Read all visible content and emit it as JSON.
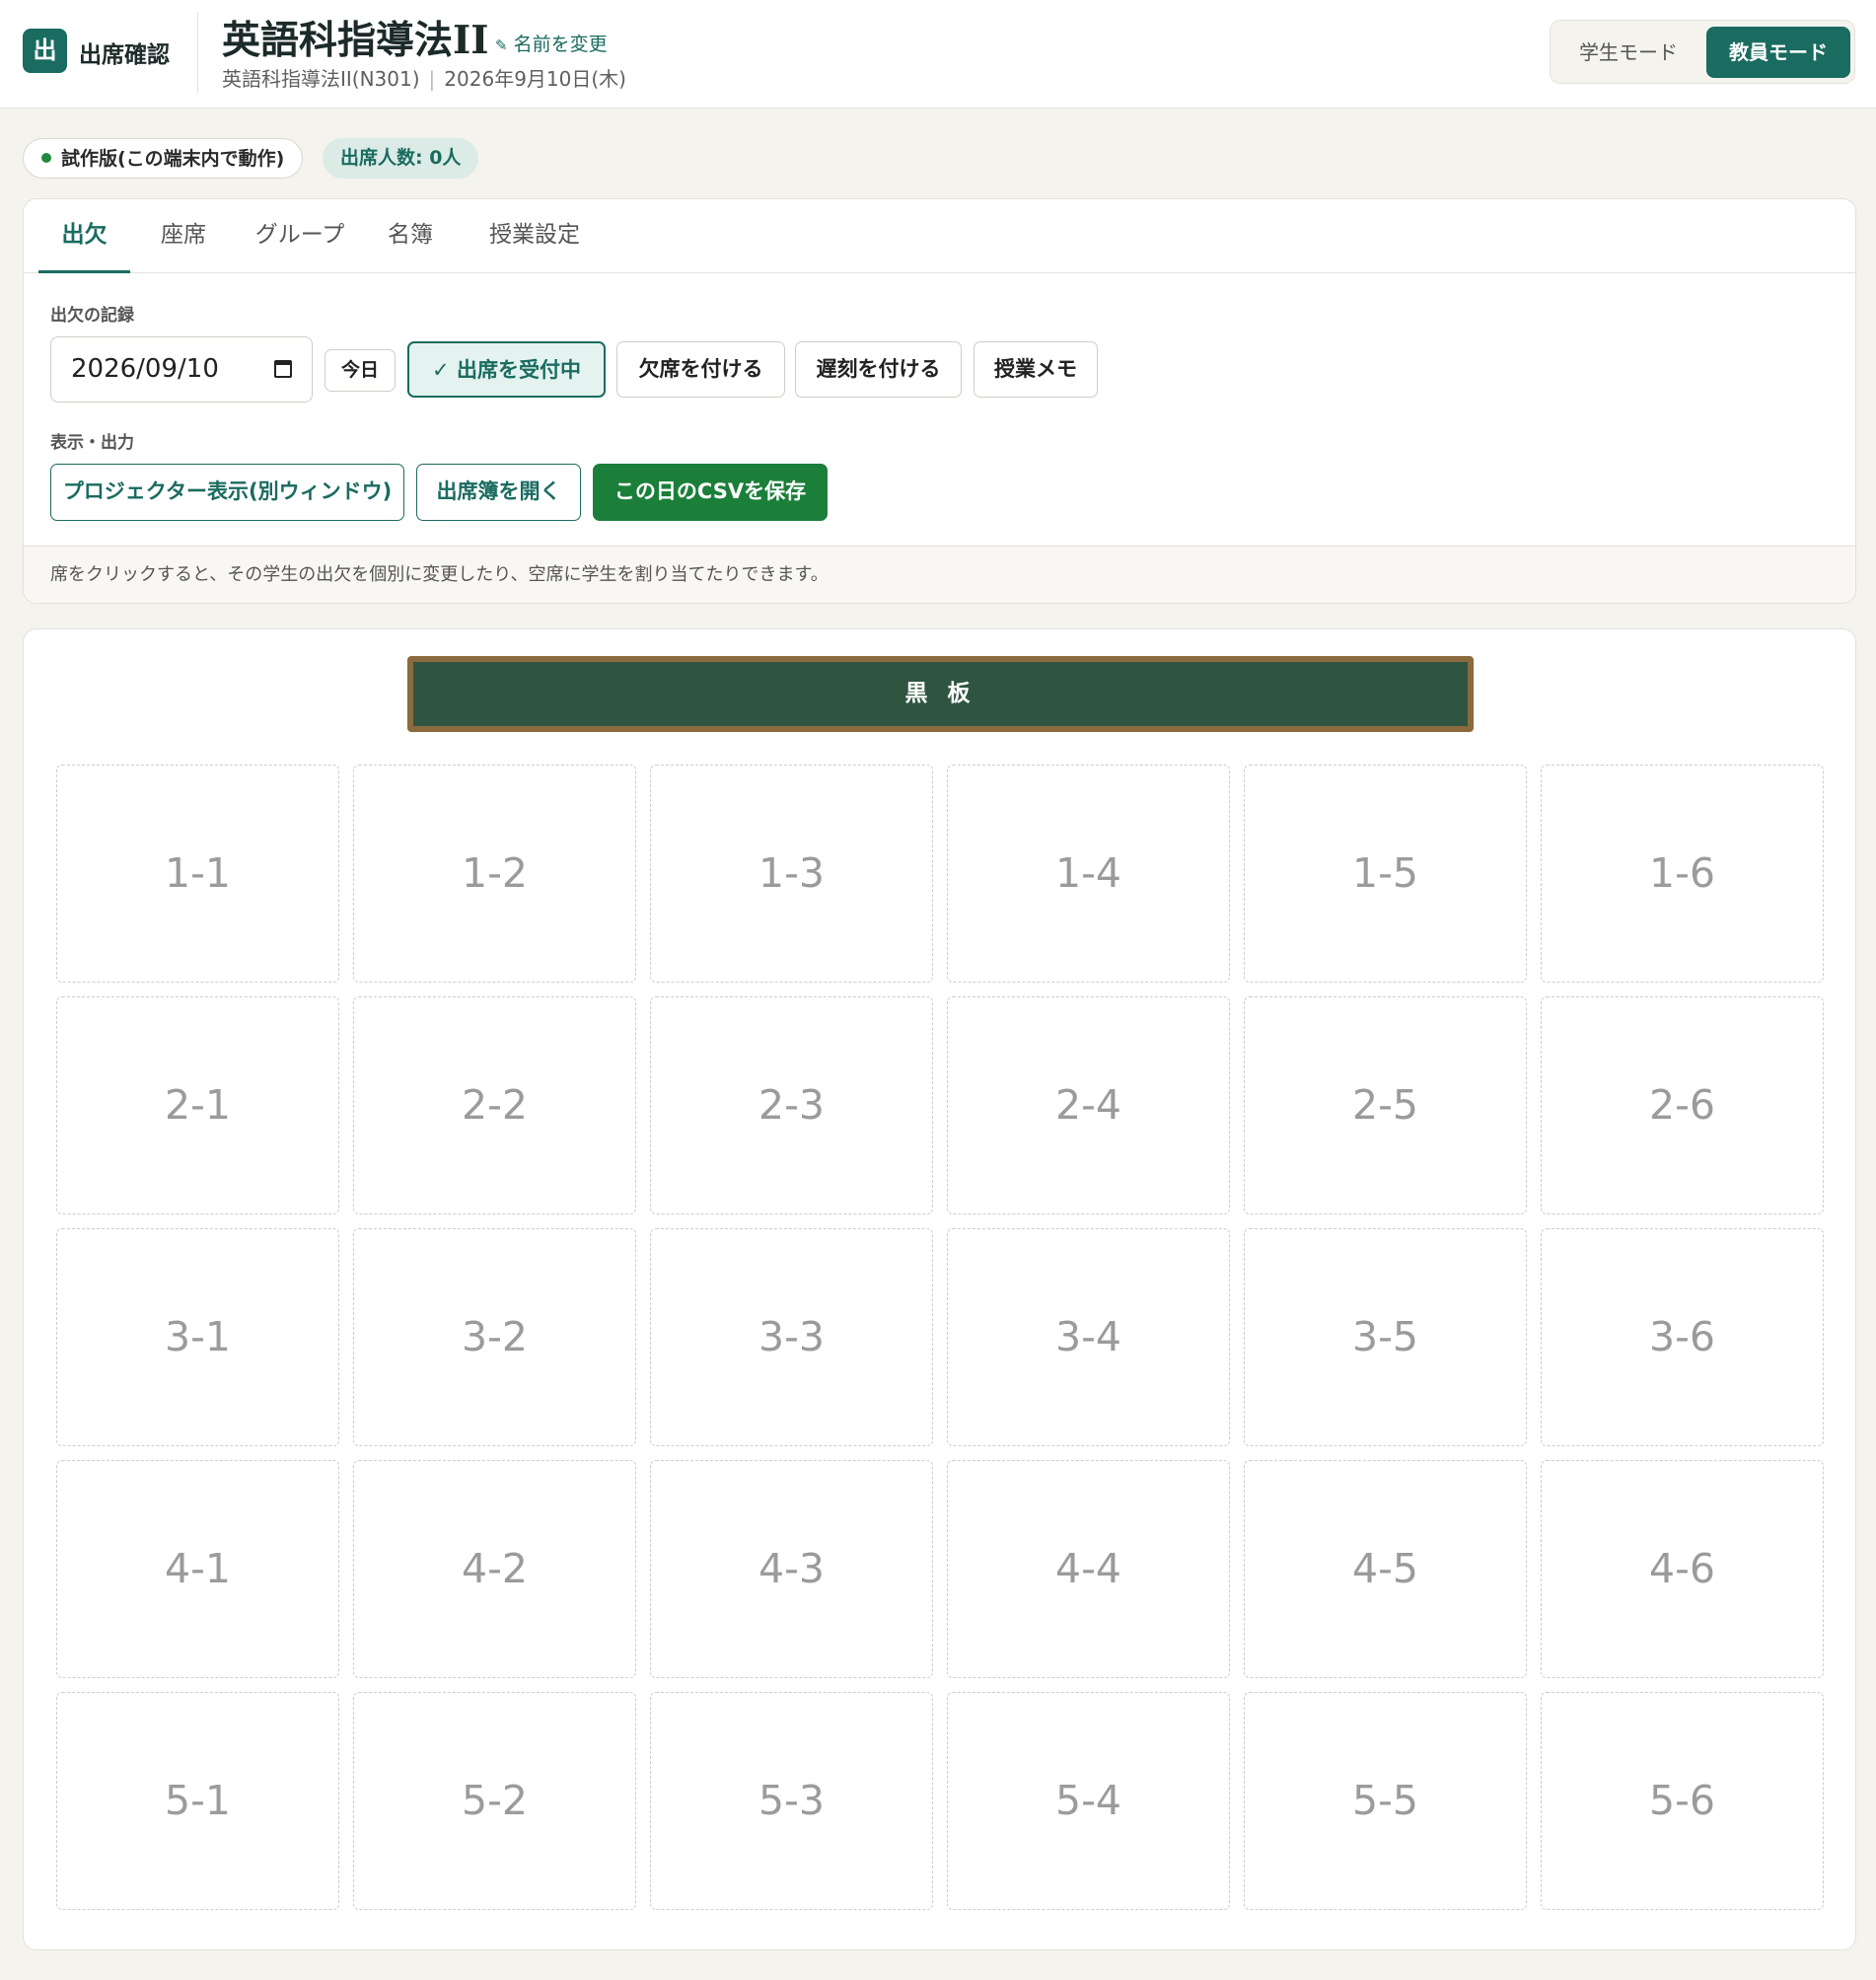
{
  "app": {
    "logo_char": "出",
    "name": "出席確認"
  },
  "course": {
    "title": "英語科指導法II",
    "rename_label": "名前を変更",
    "code": "英語科指導法II(N301)",
    "date": "2026年9月10日(木)"
  },
  "modes": {
    "student": "学生モード",
    "teacher": "教員モード",
    "active": "teacher"
  },
  "badges": {
    "prototype": "試作版(この端末内で動作)",
    "attendance_count": "出席人数: 0人"
  },
  "tabs": [
    {
      "label": "出欠",
      "active": true
    },
    {
      "label": "座席",
      "active": false
    },
    {
      "label": "グループ",
      "active": false
    },
    {
      "label": "名簿",
      "active": false
    },
    {
      "label": "授業設定",
      "active": false
    }
  ],
  "record": {
    "section_label": "出欠の記録",
    "date_value": "2026/09/10",
    "today": "今日",
    "accepting": "✓ 出席を受付中",
    "mark_absent": "欠席を付ける",
    "mark_late": "遅刻を付ける",
    "class_memo": "授業メモ"
  },
  "output": {
    "section_label": "表示・出力",
    "projector": "プロジェクター表示(別ウィンドウ)",
    "open_roster": "出席簿を開く",
    "save_csv": "この日のCSVを保存"
  },
  "hint": "席をクリックすると、その学生の出欠を個別に変更したり、空席に学生を割り当てたりできます。",
  "blackboard": "黒 板",
  "seats": [
    [
      "1-1",
      "1-2",
      "1-3",
      "1-4",
      "1-5",
      "1-6"
    ],
    [
      "2-1",
      "2-2",
      "2-3",
      "2-4",
      "2-5",
      "2-6"
    ],
    [
      "3-1",
      "3-2",
      "3-3",
      "3-4",
      "3-5",
      "3-6"
    ],
    [
      "4-1",
      "4-2",
      "4-3",
      "4-4",
      "4-5",
      "4-6"
    ],
    [
      "5-1",
      "5-2",
      "5-3",
      "5-4",
      "5-5",
      "5-6"
    ]
  ],
  "colors": {
    "accent": "#1a6b60",
    "csv_button": "#1b7f3a",
    "blackboard": "#2f5541",
    "blackboard_frame": "#8a6a3e",
    "status_dot": "#1f8a3c"
  }
}
